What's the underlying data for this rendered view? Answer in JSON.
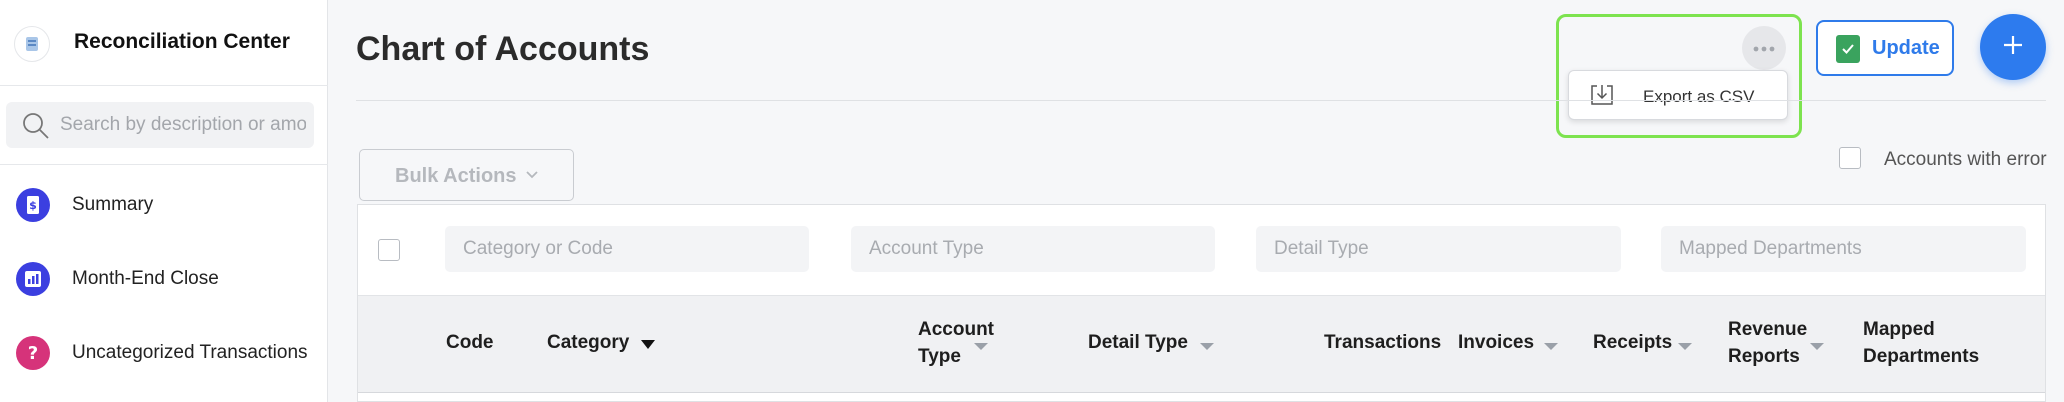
{
  "sidebar": {
    "title": "Reconciliation Center",
    "search_placeholder": "Search by description or amount",
    "items": [
      {
        "label": "Summary",
        "icon": "dollar-receipt-icon",
        "color": "#3b3fe0"
      },
      {
        "label": "Month-End Close",
        "icon": "bar-chart-icon",
        "color": "#3b3fe0"
      },
      {
        "label": "Uncategorized Transactions",
        "icon": "question-mark-icon",
        "color": "#d6337a"
      }
    ]
  },
  "header": {
    "title": "Chart of Accounts",
    "more_menu": {
      "icon": "more-horizontal-icon",
      "items": [
        {
          "label": "Export as CSV",
          "icon": "download-icon"
        }
      ]
    },
    "update_label": "Update",
    "add_icon": "plus-icon",
    "accent": "#2d7bee",
    "highlight_color": "#7de34f"
  },
  "toolbar": {
    "bulk_actions_label": "Bulk Actions",
    "accounts_with_error_label": "Accounts with error"
  },
  "filters": {
    "category_placeholder": "Category or Code",
    "account_type_placeholder": "Account Type",
    "detail_type_placeholder": "Detail Type",
    "mapped_departments_placeholder": "Mapped Departments"
  },
  "table": {
    "columns": [
      {
        "label": "Code"
      },
      {
        "label": "Category"
      },
      {
        "label_line1": "Account",
        "label_line2": "Type"
      },
      {
        "label": "Detail Type"
      },
      {
        "label": "Transactions"
      },
      {
        "label": "Invoices"
      },
      {
        "label": "Receipts"
      },
      {
        "label_line1": "Revenue",
        "label_line2": "Reports"
      },
      {
        "label_line1": "Mapped",
        "label_line2": "Departments"
      }
    ]
  }
}
